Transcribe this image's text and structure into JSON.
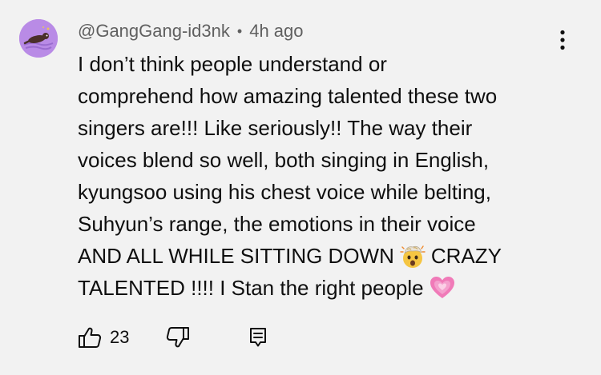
{
  "comment": {
    "author": "@GangGang-id3nk",
    "separator": "•",
    "timestamp": "4h ago",
    "lines": [
      "I don’t think people understand or",
      "comprehend how amazing talented these two",
      "singers are!!! Like seriously!! The way their",
      "voices blend so well, both singing in English,",
      "kyungsoo using his chest voice while belting,",
      "Suhyun’s range, the emotions in their voice"
    ],
    "line7_before": "AND ALL WHILE SITTING DOWN",
    "line7_after": "CRAZY",
    "line8": "TALENTED !!!! I Stan the right people",
    "emoji_1": "exploding-head-emoji",
    "emoji_2": "growing-heart-emoji"
  },
  "actions": {
    "like_count": "23",
    "like_icon": "thumbs-up-icon",
    "dislike_icon": "thumbs-down-icon",
    "reply_icon": "reply-comment-icon",
    "menu_icon": "more-vertical-icon"
  },
  "colors": {
    "background": "#f2f2f2",
    "text": "#0f0f0f",
    "secondary_text": "#606060",
    "avatar": "#b98be6"
  }
}
